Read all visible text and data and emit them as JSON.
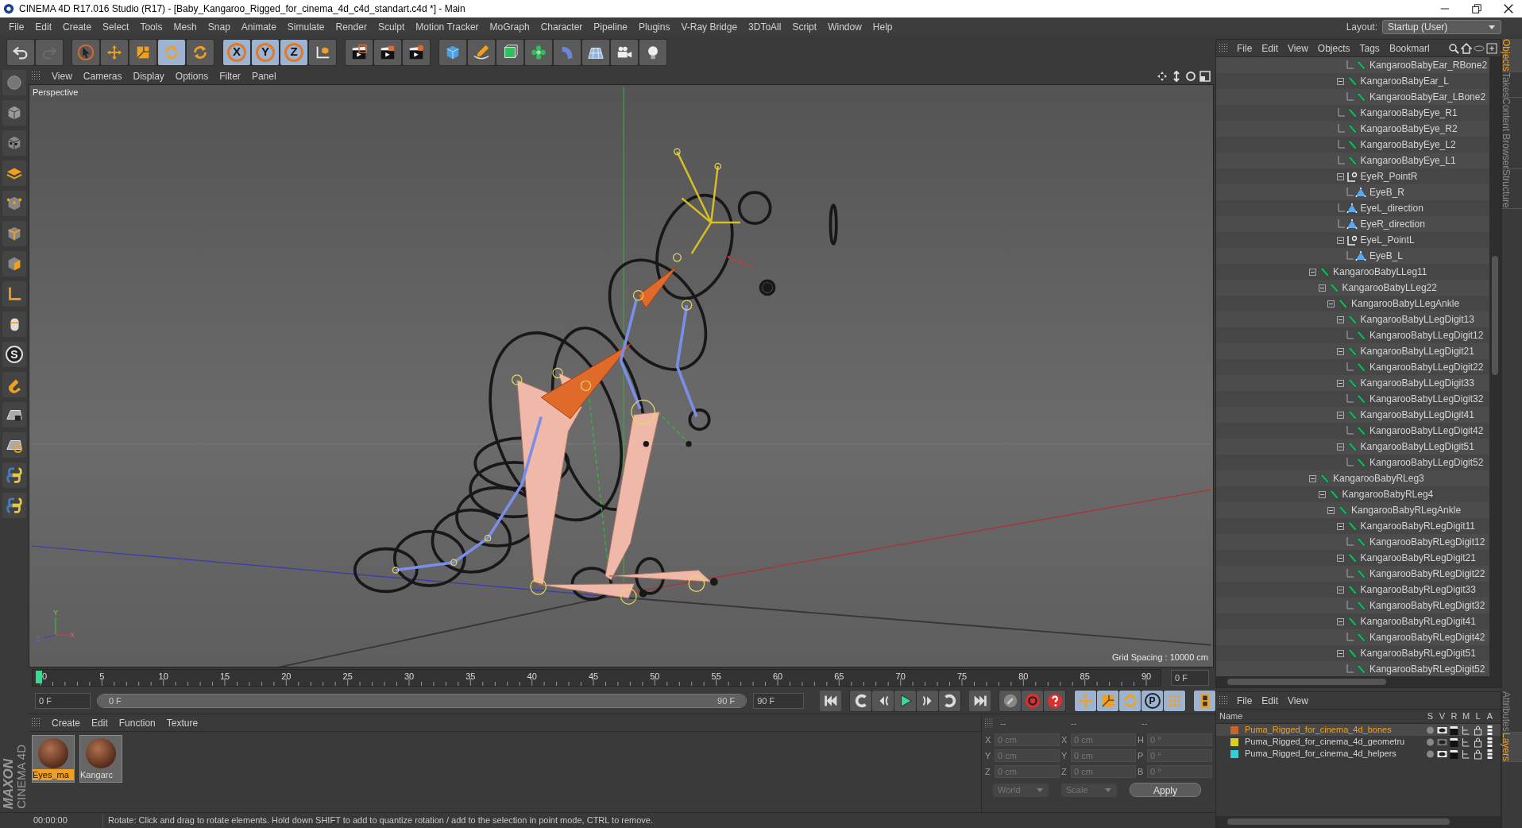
{
  "window": {
    "title": "CINEMA 4D R17.016 Studio (R17) - [Baby_Kangaroo_Rigged_for_cinema_4d_c4d_standart.c4d *] - Main"
  },
  "menu_bar": [
    "File",
    "Edit",
    "Create",
    "Select",
    "Tools",
    "Mesh",
    "Snap",
    "Animate",
    "Simulate",
    "Render",
    "Sculpt",
    "Motion Tracker",
    "MoGraph",
    "Character",
    "Pipeline",
    "Plugins",
    "V-Ray Bridge",
    "3DToAll",
    "Script",
    "Window",
    "Help"
  ],
  "layout": {
    "label": "Layout:",
    "value": "Startup (User)"
  },
  "toolbar": [
    [
      {
        "kind": "undo",
        "selected": false
      },
      {
        "kind": "redo",
        "selected": false
      }
    ],
    [
      {
        "kind": "select",
        "selected": false
      },
      {
        "kind": "move",
        "selected": false
      },
      {
        "kind": "scale",
        "selected": false
      },
      {
        "kind": "rotate",
        "selected": true
      },
      {
        "kind": "rotate",
        "selected": false
      }
    ],
    [
      {
        "kind": "axis",
        "label": "X",
        "selected": true
      },
      {
        "kind": "axis",
        "label": "Y",
        "selected": true
      },
      {
        "kind": "axis",
        "label": "Z",
        "selected": true
      },
      {
        "kind": "coords",
        "selected": false
      }
    ],
    [
      {
        "kind": "render",
        "selected": false
      },
      {
        "kind": "render-viewer",
        "selected": false
      },
      {
        "kind": "render-settings",
        "selected": false
      }
    ],
    [
      {
        "kind": "cube",
        "selected": false
      },
      {
        "kind": "pen",
        "selected": false
      },
      {
        "kind": "subdiv",
        "selected": false
      },
      {
        "kind": "cloner",
        "selected": false
      },
      {
        "kind": "bend",
        "selected": false
      },
      {
        "kind": "floor",
        "selected": false
      },
      {
        "kind": "camera",
        "selected": false
      },
      {
        "kind": "light",
        "selected": false
      }
    ]
  ],
  "side_tools": [
    {
      "kind": "sphere"
    },
    {
      "kind": "model"
    },
    {
      "kind": "texture"
    },
    {
      "kind": "workplane"
    },
    {
      "kind": "points"
    },
    {
      "kind": "edges"
    },
    {
      "kind": "polygons"
    },
    {
      "kind": "axis-l"
    },
    {
      "kind": "tweak"
    },
    {
      "kind": "snap",
      "label": "S"
    },
    {
      "kind": "magnet"
    },
    {
      "kind": "lock-grid"
    },
    {
      "kind": "grid-snap"
    },
    {
      "kind": "python"
    },
    {
      "kind": "python"
    }
  ],
  "viewport": {
    "menu": [
      "View",
      "Cameras",
      "Display",
      "Options",
      "Filter",
      "Panel"
    ],
    "camera": "Perspective",
    "grid_spacing": "Grid Spacing : 10000 cm",
    "axis_labels": [
      "Y",
      "Z",
      "X"
    ]
  },
  "timeline": {
    "ruler_labels": [
      "0",
      "5",
      "10",
      "15",
      "20",
      "25",
      "30",
      "35",
      "40",
      "45",
      "50",
      "55",
      "60",
      "65",
      "70",
      "75",
      "80",
      "85",
      "90"
    ],
    "current_frame": "0 F"
  },
  "transport": {
    "start_field": "0 F",
    "range": {
      "start": "0 F",
      "end": "90 F",
      "level": 1
    },
    "end_field": "90 F",
    "buttons": [
      [
        {
          "kind": "go-start",
          "selected": false
        }
      ],
      [
        {
          "kind": "prev-key",
          "selected": false
        },
        {
          "kind": "prev-frame",
          "selected": false
        },
        {
          "kind": "play",
          "selected": false
        },
        {
          "kind": "next-frame",
          "selected": false
        },
        {
          "kind": "next-key",
          "selected": false
        }
      ],
      [
        {
          "kind": "go-end",
          "selected": false
        }
      ],
      [
        {
          "kind": "record-off",
          "selected": false
        },
        {
          "kind": "record",
          "selected": false
        },
        {
          "kind": "help",
          "selected": false
        }
      ],
      [
        {
          "kind": "move",
          "selected": true
        },
        {
          "kind": "scale",
          "selected": true
        },
        {
          "kind": "rotate",
          "selected": true
        },
        {
          "kind": "param",
          "label": "P",
          "selected": true
        },
        {
          "kind": "pla",
          "selected": true
        }
      ],
      [
        {
          "kind": "film",
          "selected": true
        }
      ]
    ]
  },
  "logo": {
    "brand": "MAXON",
    "product": "CINEMA 4D"
  },
  "materials": {
    "menu": [
      "Create",
      "Edit",
      "Function",
      "Texture"
    ],
    "items": [
      {
        "name": "Eyes_ma",
        "selected": true
      },
      {
        "name": "Kangarc",
        "selected": false
      }
    ]
  },
  "coordinates": {
    "headers": [
      "--",
      "--",
      "--"
    ],
    "rows": [
      {
        "axis_1": "X",
        "value_1": "0 cm",
        "axis_2": "X",
        "value_2": "0 cm",
        "axis_3": "H",
        "value_3": "0 °"
      },
      {
        "axis_1": "Y",
        "value_1": "0 cm",
        "axis_2": "Y",
        "value_2": "0 cm",
        "axis_3": "P",
        "value_3": "0 °"
      },
      {
        "axis_1": "Z",
        "value_1": "0 cm",
        "axis_2": "Z",
        "value_2": "0 cm",
        "axis_3": "B",
        "value_3": "0 °"
      }
    ],
    "space": "World",
    "mode": "Scale",
    "apply": "Apply"
  },
  "objects": {
    "menu": [
      "File",
      "Edit",
      "View",
      "Objects",
      "Tags",
      "Bookmarl"
    ],
    "tree": [
      {
        "children": [
          {
            "children": [
              {
                "children": [
                  {
                    "children": [
                      {
                        "label": "KangarooBabyEar_RBone2",
                        "kind": "bone"
                      }
                    ]
                  },
                  {
                    "label": "KangarooBabyEar_L",
                    "kind": "bone",
                    "expanded": true,
                    "children": [
                      {
                        "label": "KangarooBabyEar_LBone2",
                        "kind": "bone"
                      }
                    ]
                  },
                  {
                    "label": "KangarooBabyEye_R1",
                    "kind": "bone"
                  },
                  {
                    "label": "KangarooBabyEye_R2",
                    "kind": "bone"
                  },
                  {
                    "label": "KangarooBabyEye_L2",
                    "kind": "bone"
                  },
                  {
                    "label": "KangarooBabyEye_L1",
                    "kind": "bone"
                  },
                  {
                    "label": "EyeR_PointR",
                    "kind": "null",
                    "expanded": true,
                    "children": [
                      {
                        "label": "EyeB_R",
                        "kind": "target"
                      }
                    ]
                  },
                  {
                    "label": "EyeL_direction",
                    "kind": "target"
                  },
                  {
                    "label": "EyeR_direction",
                    "kind": "target"
                  },
                  {
                    "label": "EyeL_PointL",
                    "kind": "null",
                    "expanded": true,
                    "children": [
                      {
                        "label": "EyeB_L",
                        "kind": "target"
                      }
                    ]
                  }
                ]
              }
            ]
          }
        ]
      },
      {
        "label": "KangarooBabyLLeg11",
        "kind": "bone",
        "expanded": true,
        "children": [
          {
            "label": "KangarooBabyLLeg22",
            "kind": "bone",
            "expanded": true,
            "children": [
              {
                "label": "KangarooBabyLLegAnkle",
                "kind": "bone",
                "expanded": true,
                "children": [
                  {
                    "label": "KangarooBabyLLegDigit13",
                    "kind": "bone",
                    "expanded": true,
                    "children": [
                      {
                        "label": "KangarooBabyLLegDigit12",
                        "kind": "bone"
                      }
                    ]
                  },
                  {
                    "label": "KangarooBabyLLegDigit21",
                    "kind": "bone",
                    "expanded": true,
                    "children": [
                      {
                        "label": "KangarooBabyLLegDigit22",
                        "kind": "bone"
                      }
                    ]
                  },
                  {
                    "label": "KangarooBabyLLegDigit33",
                    "kind": "bone",
                    "expanded": true,
                    "children": [
                      {
                        "label": "KangarooBabyLLegDigit32",
                        "kind": "bone"
                      }
                    ]
                  },
                  {
                    "label": "KangarooBabyLLegDigit41",
                    "kind": "bone",
                    "expanded": true,
                    "children": [
                      {
                        "label": "KangarooBabyLLegDigit42",
                        "kind": "bone"
                      }
                    ]
                  },
                  {
                    "label": "KangarooBabyLLegDigit51",
                    "kind": "bone",
                    "expanded": true,
                    "children": [
                      {
                        "label": "KangarooBabyLLegDigit52",
                        "kind": "bone"
                      }
                    ]
                  }
                ]
              }
            ]
          }
        ]
      },
      {
        "label": "KangarooBabyRLeg3",
        "kind": "bone",
        "expanded": true,
        "children": [
          {
            "label": "KangarooBabyRLeg4",
            "kind": "bone",
            "expanded": true,
            "children": [
              {
                "label": "KangarooBabyRLegAnkle",
                "kind": "bone",
                "expanded": true,
                "children": [
                  {
                    "label": "KangarooBabyRLegDigit11",
                    "kind": "bone",
                    "expanded": true,
                    "children": [
                      {
                        "label": "KangarooBabyRLegDigit12",
                        "kind": "bone"
                      }
                    ]
                  },
                  {
                    "label": "KangarooBabyRLegDigit21",
                    "kind": "bone",
                    "expanded": true,
                    "children": [
                      {
                        "label": "KangarooBabyRLegDigit22",
                        "kind": "bone"
                      }
                    ]
                  },
                  {
                    "label": "KangarooBabyRLegDigit33",
                    "kind": "bone",
                    "expanded": true,
                    "children": [
                      {
                        "label": "KangarooBabyRLegDigit32",
                        "kind": "bone"
                      }
                    ]
                  },
                  {
                    "label": "KangarooBabyRLegDigit41",
                    "kind": "bone",
                    "expanded": true,
                    "children": [
                      {
                        "label": "KangarooBabyRLegDigit42",
                        "kind": "bone"
                      }
                    ]
                  },
                  {
                    "label": "KangarooBabyRLegDigit51",
                    "kind": "bone",
                    "expanded": true,
                    "children": [
                      {
                        "label": "KangarooBabyRLegDigit52",
                        "kind": "bone"
                      }
                    ]
                  }
                ]
              }
            ]
          }
        ]
      }
    ],
    "side_tabs": [
      {
        "label": "Objects",
        "selected": true
      },
      {
        "label": "Takes",
        "selected": false
      },
      {
        "label": "Content Browser",
        "selected": false
      },
      {
        "label": "Structure",
        "selected": false
      }
    ]
  },
  "layers": {
    "menu": [
      "File",
      "Edit",
      "View"
    ],
    "columns": [
      "Name",
      "S",
      "V",
      "R",
      "M",
      "L",
      "A"
    ],
    "rows": [
      {
        "name": "Puma_Rigged_for_cinema_4d_bones",
        "color": "#c8632a",
        "selected": true,
        "visible": true
      },
      {
        "name": "Puma_Rigged_for_cinema_4d_geometru",
        "color": "#d8d020",
        "selected": false,
        "visible": false
      },
      {
        "name": "Puma_Rigged_for_cinema_4d_helpers",
        "color": "#30d0d8",
        "selected": false,
        "visible": true
      }
    ],
    "side_tabs": [
      {
        "label": "Attributes",
        "selected": false
      },
      {
        "label": "Layers",
        "selected": true
      }
    ]
  },
  "status_bar": {
    "time": "00:00:00",
    "message": "Rotate: Click and drag to rotate elements. Hold down SHIFT to add to quantize rotation / add to the selection in point mode, CTRL to remove."
  }
}
